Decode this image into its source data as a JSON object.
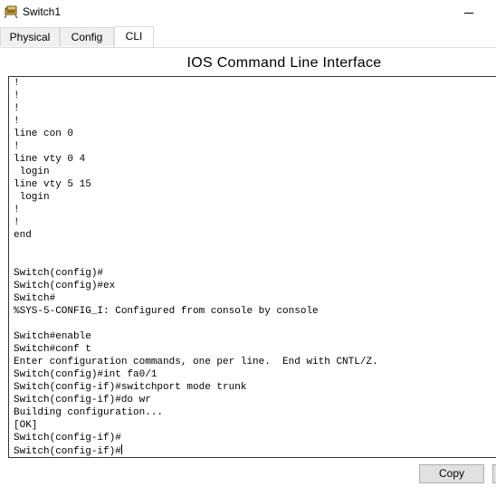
{
  "window": {
    "title": "Switch1",
    "app_icon": "cisco-bridge-icon",
    "minimize_icon": "minimize-icon"
  },
  "tabs": [
    {
      "label": "Physical",
      "active": false
    },
    {
      "label": "Config",
      "active": false
    },
    {
      "label": "CLI",
      "active": true
    }
  ],
  "cli": {
    "heading": "IOS Command Line Interface",
    "lines": [
      "!",
      "!",
      "!",
      "!",
      "line con 0",
      "!",
      "line vty 0 4",
      " login",
      "line vty 5 15",
      " login",
      "!",
      "!",
      "end",
      "",
      "",
      "Switch(config)#",
      "Switch(config)#ex",
      "Switch#",
      "%SYS-5-CONFIG_I: Configured from console by console",
      "",
      "Switch#enable",
      "Switch#conf t",
      "Enter configuration commands, one per line.  End with CNTL/Z.",
      "Switch(config)#int fa0/1",
      "Switch(config-if)#switchport mode trunk",
      "Switch(config-if)#do wr",
      "Building configuration...",
      "[OK]",
      "Switch(config-if)#",
      "Switch(config-if)#"
    ]
  },
  "buttons": {
    "copy_label": "Copy"
  },
  "colors": {
    "terminal_border": "#333333",
    "tab_inactive_bg": "#f0f0f0",
    "button_bg": "#e1e1e1"
  }
}
